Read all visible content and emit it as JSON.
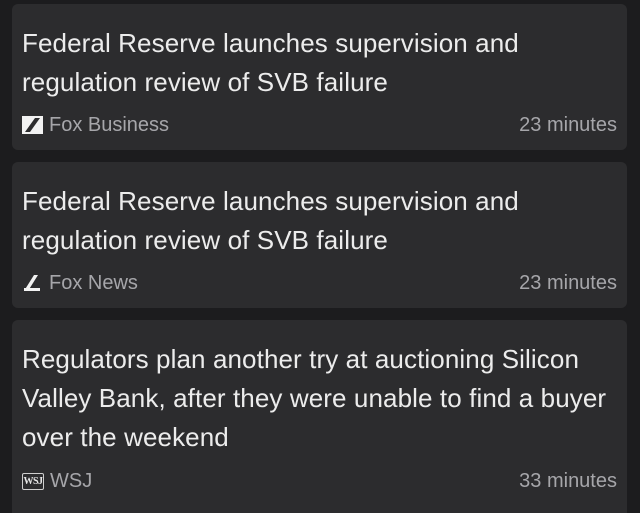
{
  "articles": [
    {
      "headline": "Federal Reserve launches supervision and regulation review of SVB failure",
      "source": "Fox Business",
      "source_icon": "fox-business-logo-icon",
      "time": "23 minutes"
    },
    {
      "headline": "Federal Reserve launches supervision and regulation review of SVB failure",
      "source": "Fox News",
      "source_icon": "fox-news-logo-icon",
      "time": "23 minutes"
    },
    {
      "headline": "Regulators plan another try at auctioning Silicon Valley Bank, after they were unable to find a buyer over the weekend",
      "source": "WSJ",
      "source_icon": "wsj-logo-icon",
      "source_icon_text": "WSJ",
      "time": "33 minutes"
    }
  ],
  "colors": {
    "background": "#1c1c1e",
    "card": "#2c2c2e",
    "headline_text": "#ececec",
    "meta_text": "#a6a6aa"
  }
}
